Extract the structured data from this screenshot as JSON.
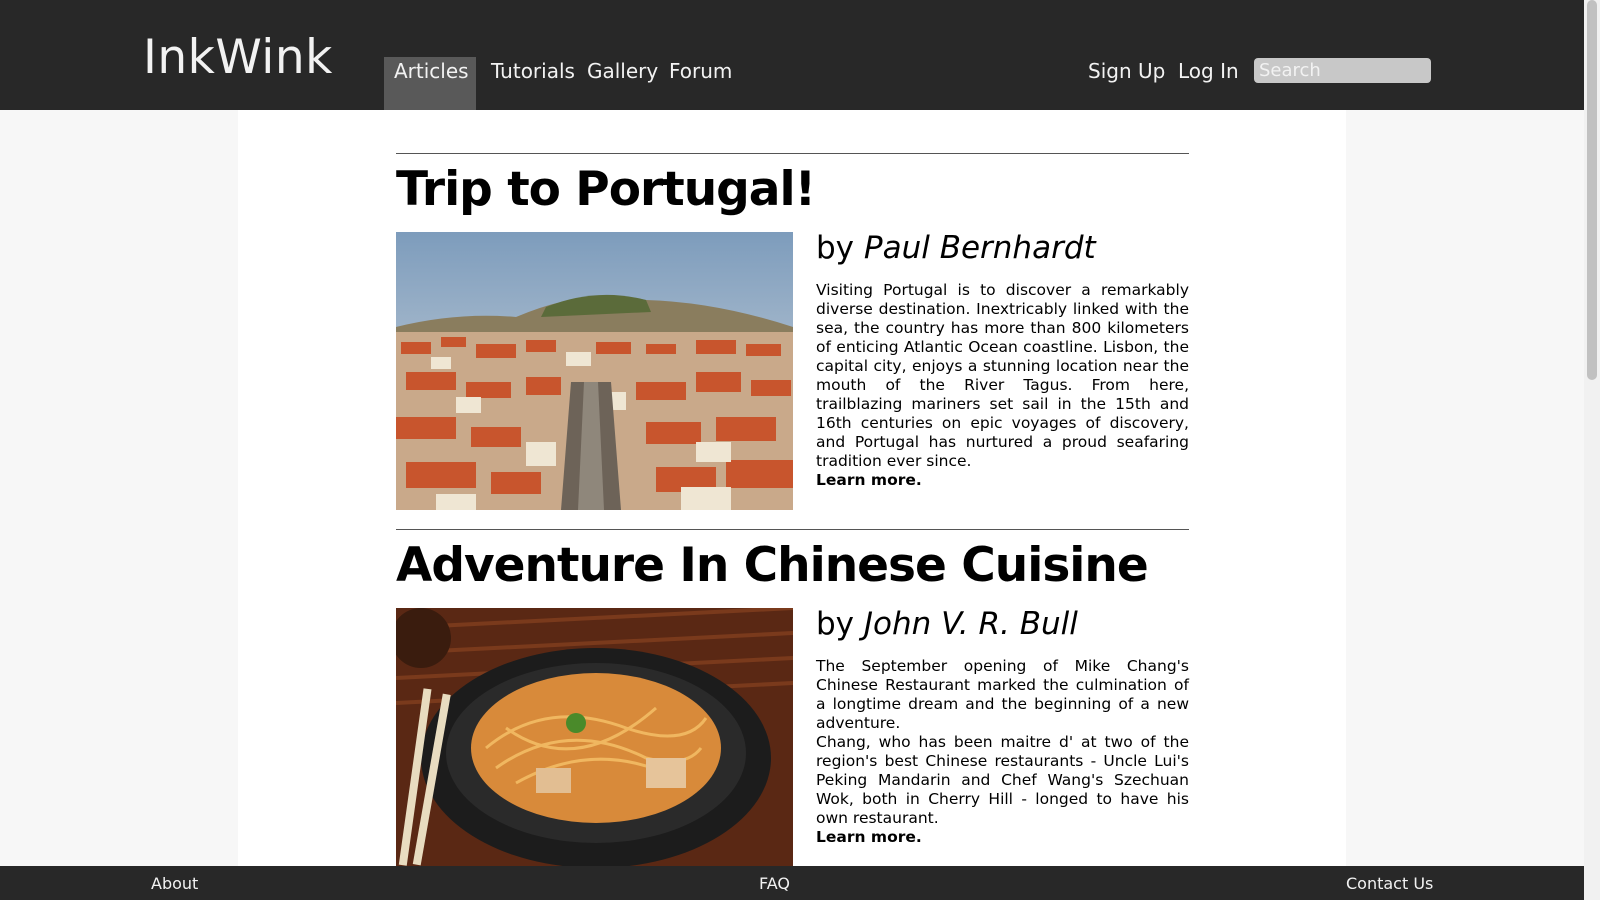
{
  "header": {
    "logo": "InkWink",
    "nav": [
      "Articles",
      "Tutorials",
      "Gallery",
      "Forum"
    ],
    "active_nav": "Articles",
    "sign_up": "Sign Up",
    "log_in": "Log In",
    "search_placeholder": "Search"
  },
  "articles": [
    {
      "title": "Trip to Portugal!",
      "by": "by",
      "author": "Paul Bernhardt",
      "paragraphs": [
        "Visiting Portugal is to discover a remarkably diverse destination. Inextricably linked with the sea, the country has more than 800 kilometers of enticing Atlantic Ocean coastline. Lisbon, the capital city, enjoys a stunning location near the mouth of the River Tagus. From here, trailblazing mariners set sail in the 15th and 16th centuries on epic voyages of discovery, and Portugal has nurtured a proud seafaring tradition ever since."
      ],
      "learn_more": "Learn more."
    },
    {
      "title": "Adventure In Chinese Cuisine",
      "by": "by",
      "author": "John V. R. Bull",
      "paragraphs": [
        "The September opening of Mike Chang's Chinese Restaurant marked the culmination of a longtime dream and the beginning of a new adventure.",
        "Chang, who has been maitre d' at two of the region's best Chinese restaurants - Uncle Lui's Peking Mandarin and Chef Wang's Szechuan Wok, both in Cherry Hill - longed to have his own restaurant."
      ],
      "learn_more": "Learn more."
    }
  ],
  "footer": {
    "about": "About",
    "faq": "FAQ",
    "contact": "Contact Us"
  }
}
